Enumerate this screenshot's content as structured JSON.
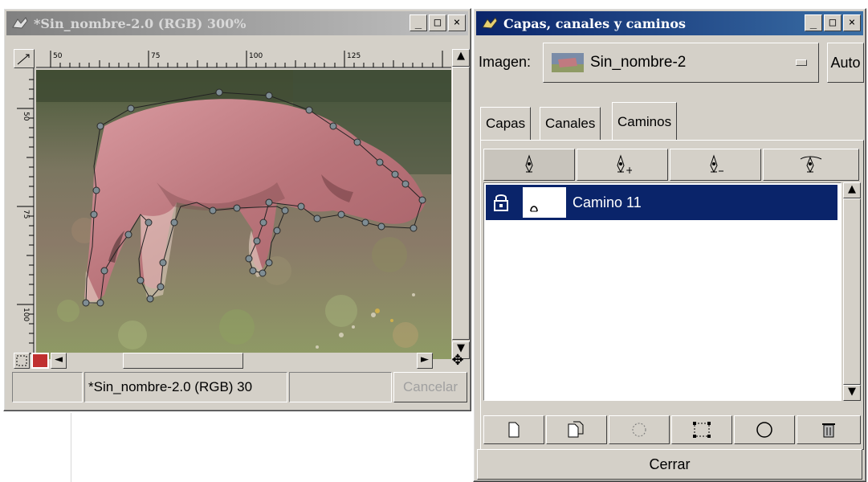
{
  "image_window": {
    "title": "*Sin_nombre-2.0 (RGB) 300%",
    "controls": {
      "minimize": "_",
      "maximize": "□",
      "close": "×"
    },
    "ruler_h_labels": [
      "50",
      "75",
      "100",
      "125"
    ],
    "ruler_v_labels": [
      "50",
      "75",
      "100"
    ],
    "status_title": "*Sin_nombre-2.0 (RGB) 30",
    "cancel_label": "Cancelar"
  },
  "paths_dialog": {
    "title": "Capas, canales y caminos",
    "controls": {
      "minimize": "_",
      "maximize": "□",
      "close": "×"
    },
    "image_label": "Imagen:",
    "image_value": "Sin_nombre-2",
    "auto_label": "Auto",
    "tabs": [
      {
        "label": "Capas",
        "active": false
      },
      {
        "label": "Canales",
        "active": false
      },
      {
        "label": "Caminos",
        "active": true
      }
    ],
    "tools": [
      {
        "icon": "pen-new-point-icon"
      },
      {
        "icon": "pen-add-point-icon"
      },
      {
        "icon": "pen-remove-point-icon"
      },
      {
        "icon": "pen-edit-point-icon"
      }
    ],
    "paths": [
      {
        "name": "Camino 11",
        "locked": true,
        "selected": true
      }
    ],
    "bottom_buttons": [
      {
        "icon": "new-path-icon"
      },
      {
        "icon": "duplicate-path-icon"
      },
      {
        "icon": "path-to-selection-icon"
      },
      {
        "icon": "selection-to-path-icon"
      },
      {
        "icon": "stroke-path-icon"
      },
      {
        "icon": "delete-path-icon"
      }
    ],
    "close_label": "Cerrar"
  },
  "colors": {
    "chrome": "#d4d0c8",
    "selection": "#0a246a",
    "active_title": "#0a246a",
    "inactive_title": "#808080"
  }
}
